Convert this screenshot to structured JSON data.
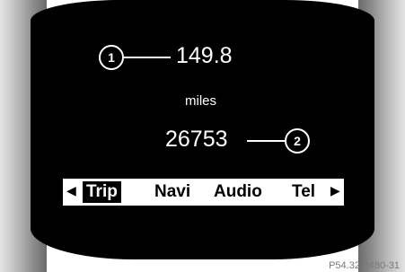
{
  "display": {
    "trip_distance": "149.8",
    "distance_unit": "miles",
    "odometer": "26753"
  },
  "callouts": {
    "one": "1",
    "two": "2"
  },
  "menu": {
    "left_arrow": "◀",
    "right_arrow": "▶",
    "items": [
      {
        "label": "Trip",
        "selected": true
      },
      {
        "label": "Navi",
        "selected": false
      },
      {
        "label": "Audio",
        "selected": false
      },
      {
        "label": "Tel",
        "selected": false
      }
    ]
  },
  "figure_ref": "P54.32-8480-31",
  "colors": {
    "screen_background": "#000000",
    "screen_text": "#ffffff",
    "menu_background": "#ffffff",
    "menu_selected_background": "#000000"
  }
}
